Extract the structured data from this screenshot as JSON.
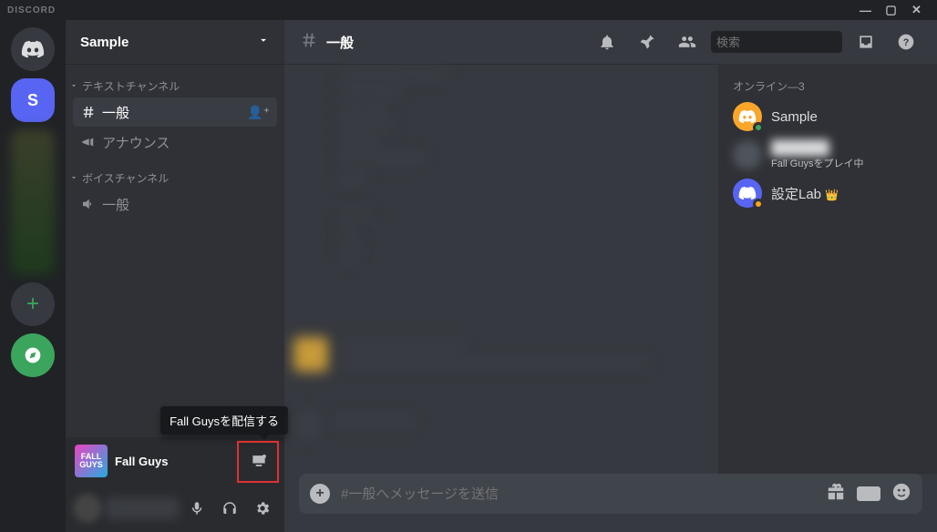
{
  "titlebar": {
    "brand": "DISCORD"
  },
  "server": {
    "name": "Sample"
  },
  "categories": {
    "text": {
      "label": "テキストチャンネル"
    },
    "voice": {
      "label": "ボイスチャンネル"
    }
  },
  "channels": {
    "general": {
      "name": "一般"
    },
    "announce": {
      "name": "アナウンス"
    },
    "voice_general": {
      "name": "一般"
    }
  },
  "guild_initial": "S",
  "chat": {
    "title": "一般",
    "compose_placeholder": "#一般へメッセージを送信"
  },
  "game": {
    "name": "Fall Guys",
    "icon_text": "FALL\nGUYS",
    "tooltip": "Fall Guysを配信する"
  },
  "search": {
    "placeholder": "検索"
  },
  "members": {
    "heading": "オンライン—3",
    "list": [
      {
        "name": "Sample",
        "activity": "",
        "avatar_bg": "#f9a62b",
        "status": "#3ba55d"
      },
      {
        "name": "██████",
        "activity": "Fall Guysをプレイ中",
        "avatar_bg": "#4f545c",
        "status": ""
      },
      {
        "name": "設定Lab",
        "activity": "",
        "avatar_bg": "#5865f2",
        "status": "#faa61a",
        "owner": true
      }
    ]
  },
  "gif_label": "GIF"
}
